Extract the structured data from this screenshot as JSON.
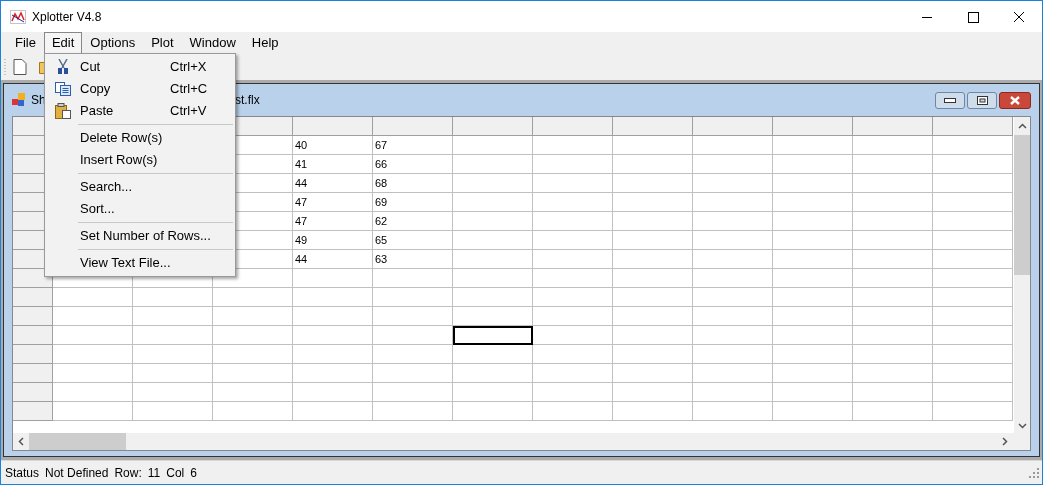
{
  "window": {
    "title": "Xplotter V4.8"
  },
  "menubar": [
    {
      "label": "File",
      "selected": false
    },
    {
      "label": "Edit",
      "selected": true
    },
    {
      "label": "Options",
      "selected": false
    },
    {
      "label": "Plot",
      "selected": false
    },
    {
      "label": "Window",
      "selected": false
    },
    {
      "label": "Help",
      "selected": false
    }
  ],
  "edit_menu": [
    {
      "kind": "command",
      "label": "Cut",
      "shortcut": "Ctrl+X"
    },
    {
      "kind": "command",
      "label": "Copy",
      "shortcut": "Ctrl+C"
    },
    {
      "kind": "command",
      "label": "Paste",
      "shortcut": "Ctrl+V"
    },
    {
      "kind": "separator"
    },
    {
      "kind": "command",
      "label": "Delete Row(s)"
    },
    {
      "kind": "command",
      "label": "Insert Row(s)"
    },
    {
      "kind": "separator"
    },
    {
      "kind": "command",
      "label": "Search..."
    },
    {
      "kind": "command",
      "label": "Sort..."
    },
    {
      "kind": "separator"
    },
    {
      "kind": "command",
      "label": "Set Number of Rows..."
    },
    {
      "kind": "separator"
    },
    {
      "kind": "command",
      "label": "View Text File..."
    }
  ],
  "child_window": {
    "title_start": "Sh",
    "title_end": "st.flx"
  },
  "grid": {
    "rows": [
      {
        "cells": [
          {
            "selected": false
          },
          {
            "text": "40",
            "selected": false
          },
          {
            "text": "67",
            "selected": false
          },
          {
            "selected": false
          },
          {
            "selected": false
          },
          {
            "selected": false
          },
          {
            "selected": false
          },
          {
            "selected": false
          },
          {
            "selected": false
          },
          {
            "selected": false
          }
        ]
      },
      {
        "cells": [
          {
            "selected": false
          },
          {
            "text": "41",
            "selected": false
          },
          {
            "text": "66",
            "selected": false
          },
          {
            "selected": false
          },
          {
            "selected": false
          },
          {
            "selected": false
          },
          {
            "selected": false
          },
          {
            "selected": false
          },
          {
            "selected": false
          },
          {
            "selected": false
          }
        ]
      },
      {
        "cells": [
          {
            "selected": false
          },
          {
            "text": "44",
            "selected": false
          },
          {
            "text": "68",
            "selected": false
          },
          {
            "selected": false
          },
          {
            "selected": false
          },
          {
            "selected": false
          },
          {
            "selected": false
          },
          {
            "selected": false
          },
          {
            "selected": false
          },
          {
            "selected": false
          }
        ]
      },
      {
        "cells": [
          {
            "selected": false
          },
          {
            "text": "47",
            "selected": false
          },
          {
            "text": "69",
            "selected": false
          },
          {
            "selected": false
          },
          {
            "selected": false
          },
          {
            "selected": false
          },
          {
            "selected": false
          },
          {
            "selected": false
          },
          {
            "selected": false
          },
          {
            "selected": false
          }
        ]
      },
      {
        "cells": [
          {
            "selected": false
          },
          {
            "text": "47",
            "selected": false
          },
          {
            "text": "62",
            "selected": false
          },
          {
            "selected": false
          },
          {
            "selected": false
          },
          {
            "selected": false
          },
          {
            "selected": false
          },
          {
            "selected": false
          },
          {
            "selected": false
          },
          {
            "selected": false
          }
        ]
      },
      {
        "cells": [
          {
            "selected": false
          },
          {
            "text": "49",
            "selected": false
          },
          {
            "text": "65",
            "selected": false
          },
          {
            "selected": false
          },
          {
            "selected": false
          },
          {
            "selected": false
          },
          {
            "selected": false
          },
          {
            "selected": false
          },
          {
            "selected": false
          },
          {
            "selected": false
          }
        ]
      },
      {
        "cells": [
          {
            "selected": false
          },
          {
            "text": "44",
            "selected": false
          },
          {
            "text": "63",
            "selected": false
          },
          {
            "selected": false
          },
          {
            "selected": false
          },
          {
            "selected": false
          },
          {
            "selected": false
          },
          {
            "selected": false
          },
          {
            "selected": false
          },
          {
            "selected": false
          }
        ]
      },
      {
        "cells": [
          {
            "selected": false
          },
          {
            "selected": false
          },
          {
            "selected": false
          },
          {
            "selected": false
          },
          {
            "selected": false
          },
          {
            "selected": false
          },
          {
            "selected": false
          },
          {
            "selected": false
          },
          {
            "selected": false
          },
          {
            "selected": false
          },
          {
            "selected": false
          },
          {
            "selected": false
          }
        ]
      },
      {
        "cells": [
          {
            "selected": false
          },
          {
            "selected": false
          },
          {
            "selected": false
          },
          {
            "selected": false
          },
          {
            "selected": false
          },
          {
            "selected": false
          },
          {
            "selected": false
          },
          {
            "selected": false
          },
          {
            "selected": false
          },
          {
            "selected": false
          },
          {
            "selected": false
          },
          {
            "selected": false
          }
        ]
      },
      {
        "cells": [
          {
            "selected": false
          },
          {
            "selected": false
          },
          {
            "selected": false
          },
          {
            "selected": false
          },
          {
            "selected": false
          },
          {
            "selected": false
          },
          {
            "selected": false
          },
          {
            "selected": false
          },
          {
            "selected": false
          },
          {
            "selected": false
          },
          {
            "selected": false
          },
          {
            "selected": false
          }
        ]
      },
      {
        "cells": [
          {
            "selected": false
          },
          {
            "selected": false
          },
          {
            "selected": false
          },
          {
            "selected": false
          },
          {
            "selected": false
          },
          {
            "selected": true
          },
          {
            "selected": false
          },
          {
            "selected": false
          },
          {
            "selected": false
          },
          {
            "selected": false
          },
          {
            "selected": false
          },
          {
            "selected": false
          }
        ]
      },
      {
        "cells": [
          {
            "selected": false
          },
          {
            "selected": false
          },
          {
            "selected": false
          },
          {
            "selected": false
          },
          {
            "selected": false
          },
          {
            "selected": false
          },
          {
            "selected": false
          },
          {
            "selected": false
          },
          {
            "selected": false
          },
          {
            "selected": false
          },
          {
            "selected": false
          },
          {
            "selected": false
          }
        ]
      },
      {
        "cells": [
          {
            "selected": false
          },
          {
            "selected": false
          },
          {
            "selected": false
          },
          {
            "selected": false
          },
          {
            "selected": false
          },
          {
            "selected": false
          },
          {
            "selected": false
          },
          {
            "selected": false
          },
          {
            "selected": false
          },
          {
            "selected": false
          },
          {
            "selected": false
          },
          {
            "selected": false
          }
        ]
      },
      {
        "cells": [
          {
            "selected": false
          },
          {
            "selected": false
          },
          {
            "selected": false
          },
          {
            "selected": false
          },
          {
            "selected": false
          },
          {
            "selected": false
          },
          {
            "selected": false
          },
          {
            "selected": false
          },
          {
            "selected": false
          },
          {
            "selected": false
          },
          {
            "selected": false
          },
          {
            "selected": false
          }
        ]
      },
      {
        "cells": [
          {
            "selected": false
          },
          {
            "selected": false
          },
          {
            "selected": false
          },
          {
            "selected": false
          },
          {
            "selected": false
          },
          {
            "selected": false
          },
          {
            "selected": false
          },
          {
            "selected": false
          },
          {
            "selected": false
          },
          {
            "selected": false
          },
          {
            "selected": false
          },
          {
            "selected": false
          }
        ]
      }
    ]
  },
  "status_bar": [
    {
      "label": "Status",
      "value": "Not Defined"
    },
    {
      "label": "Row:",
      "value": "11"
    },
    {
      "label": "Col",
      "value": "6"
    }
  ]
}
